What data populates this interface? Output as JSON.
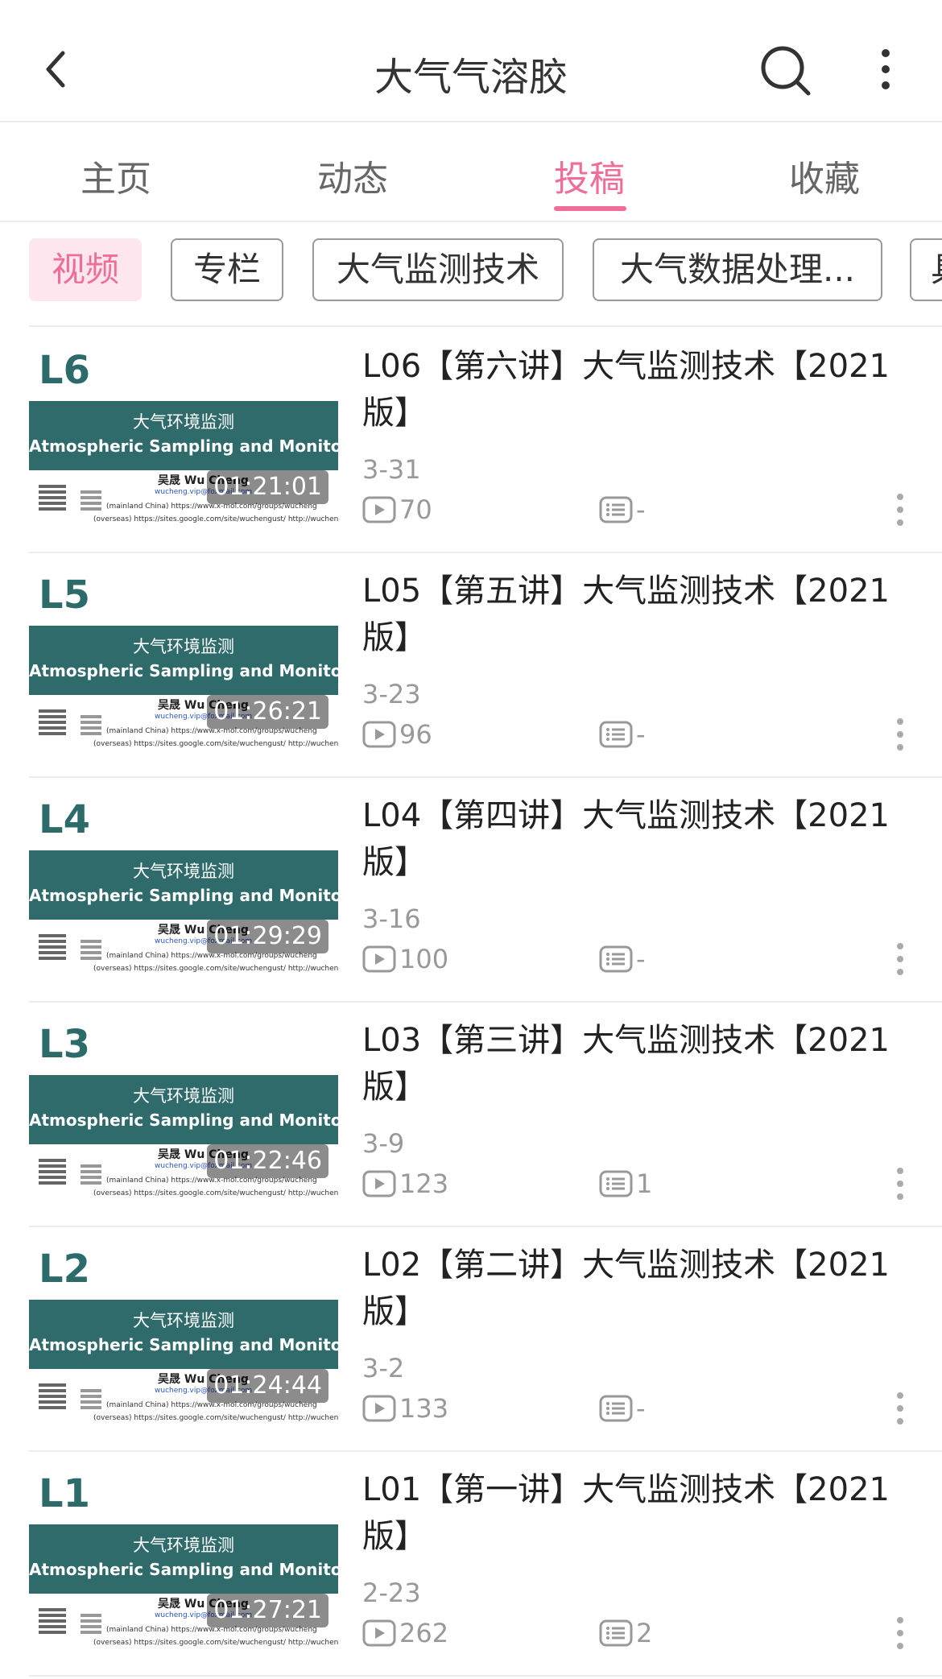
{
  "header": {
    "title": "大气气溶胶",
    "back_icon": "chevron-left-icon",
    "search_icon": "search-icon",
    "more_icon": "more-vertical-icon"
  },
  "tabs": [
    {
      "label": "主页",
      "active": false
    },
    {
      "label": "动态",
      "active": false
    },
    {
      "label": "投稿",
      "active": true
    },
    {
      "label": "收藏",
      "active": false
    }
  ],
  "chips": [
    {
      "label": "视频",
      "active": true
    },
    {
      "label": "专栏",
      "active": false
    },
    {
      "label": "大气监测技术",
      "active": false
    },
    {
      "label": "大气数据处理...",
      "active": false
    },
    {
      "label": "具",
      "active": false
    }
  ],
  "thumbnail": {
    "band_cn": "大气环境监测",
    "band_en": "Atmospheric Sampling and Monitoring",
    "author": "吴晟 Wu Cheng",
    "link1": "wucheng.vip@foxmail.com",
    "link2": "(mainland China) https://www.x-mol.com/groups/wucheng",
    "link3": "(overseas) https://sites.google.com/site/wuchengust/ http://wucheng.weebly.com/"
  },
  "videos": [
    {
      "tag": "L6",
      "duration": "01:21:01",
      "title": "L06【第六讲】大气监测技术【2021版】",
      "date": "3-31",
      "plays": "70",
      "comments": "-"
    },
    {
      "tag": "L5",
      "duration": "01:26:21",
      "title": "L05【第五讲】大气监测技术【2021版】",
      "date": "3-23",
      "plays": "96",
      "comments": "-"
    },
    {
      "tag": "L4",
      "duration": "01:29:29",
      "title": "L04【第四讲】大气监测技术【2021版】",
      "date": "3-16",
      "plays": "100",
      "comments": "-"
    },
    {
      "tag": "L3",
      "duration": "01:22:46",
      "title": "L03【第三讲】大气监测技术【2021版】",
      "date": "3-9",
      "plays": "123",
      "comments": "1"
    },
    {
      "tag": "L2",
      "duration": "01:24:44",
      "title": "L02【第二讲】大气监测技术【2021版】",
      "date": "3-2",
      "plays": "133",
      "comments": "-"
    },
    {
      "tag": "L1",
      "duration": "01:27:21",
      "title": "L01【第一讲】大气监测技术【2021版】",
      "date": "2-23",
      "plays": "262",
      "comments": "2"
    }
  ],
  "colors": {
    "accent": "#f06d99",
    "chip_active_bg": "#fde6ed",
    "thumb_band": "#2f6b6b",
    "muted_text": "#999999"
  }
}
